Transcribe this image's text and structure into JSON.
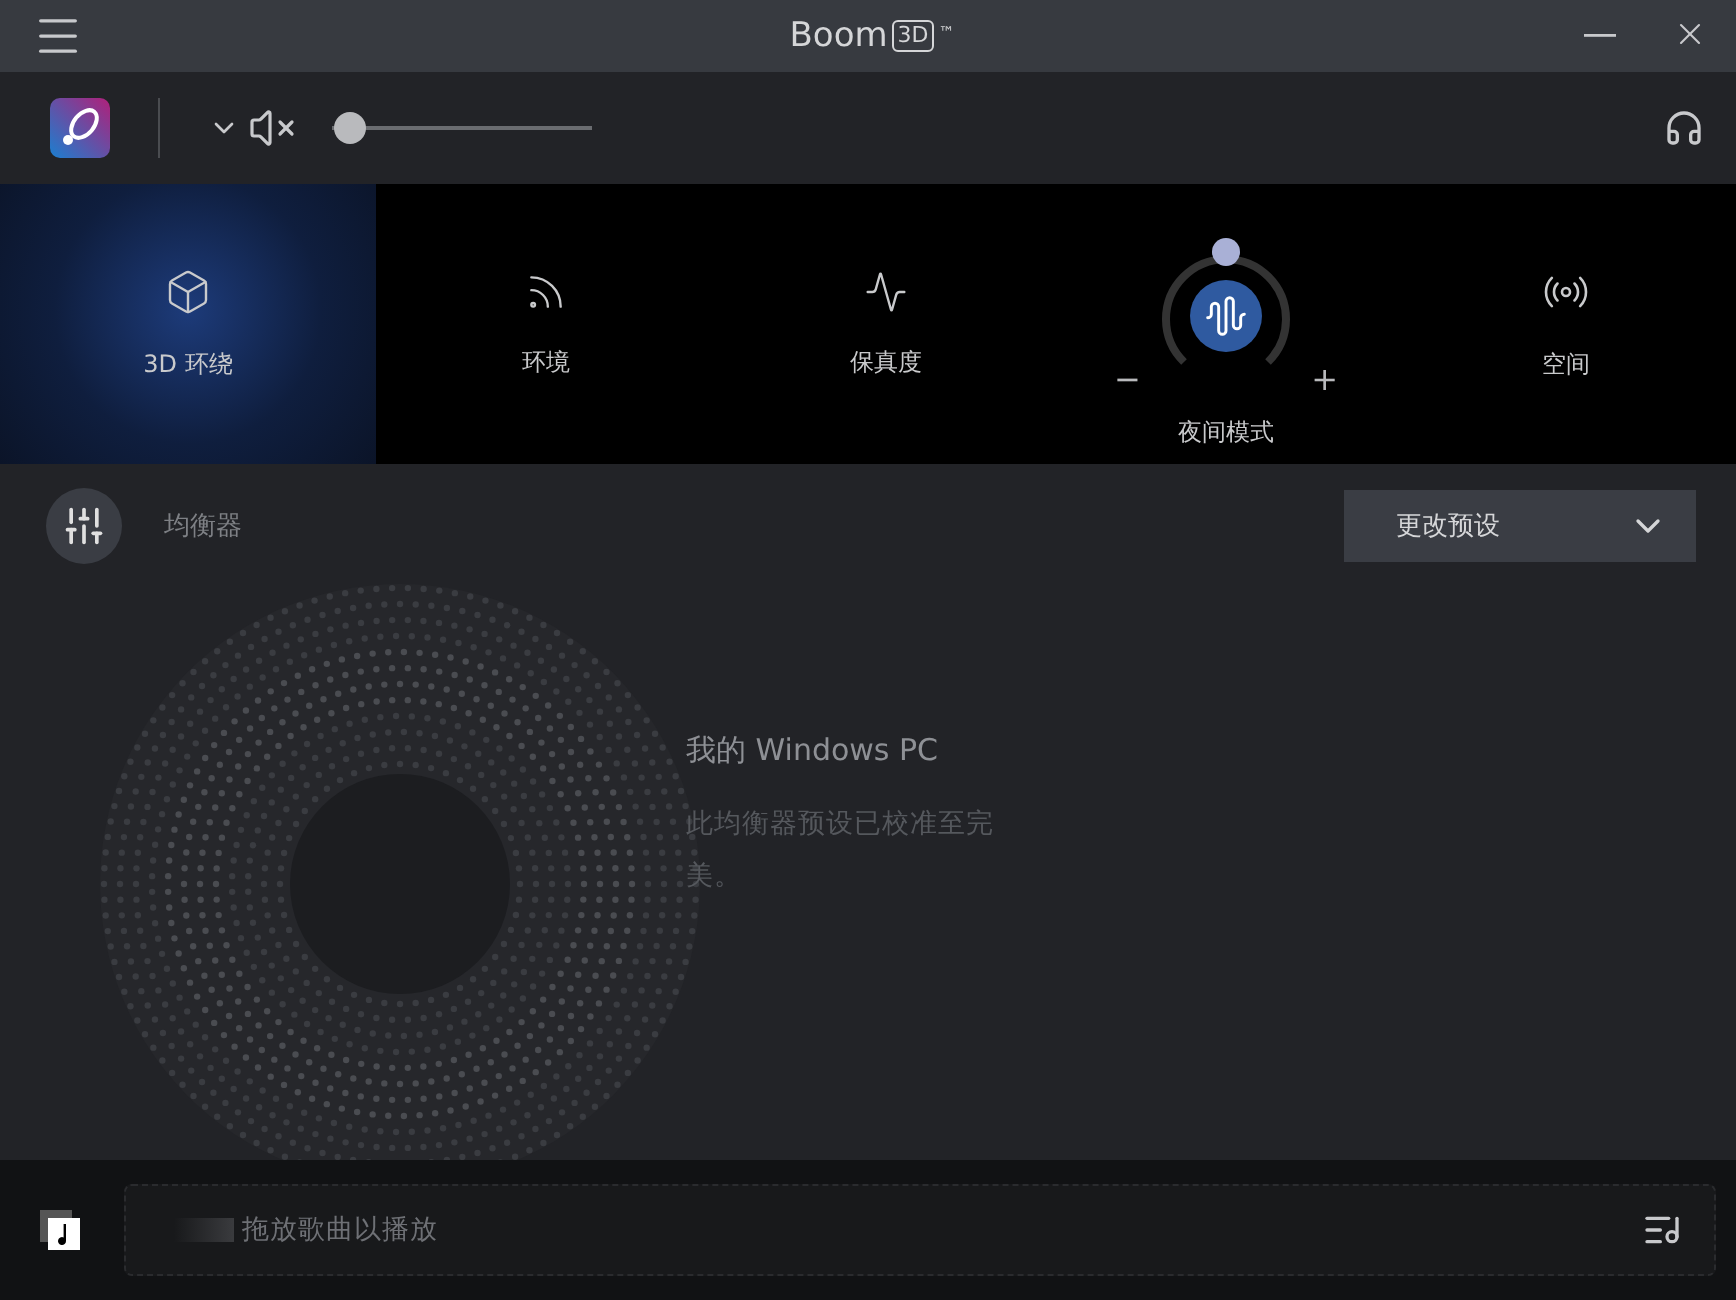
{
  "window": {
    "title": "Boom",
    "title_badge": "3D",
    "trademark": "™"
  },
  "toolbar": {
    "muted": true,
    "volume": {
      "level": 0.07
    }
  },
  "effects": [
    {
      "kind": "toggle",
      "label": "3D 环绕",
      "selected": true
    },
    {
      "kind": "toggle",
      "label": "环境",
      "selected": false
    },
    {
      "kind": "toggle",
      "label": "保真度",
      "selected": false
    },
    {
      "kind": "dial",
      "label": "夜间模式",
      "selected": false,
      "minus": "−",
      "plus": "+"
    },
    {
      "kind": "toggle",
      "label": "空间",
      "selected": false
    }
  ],
  "equalizer": {
    "label": "均衡器",
    "preset_button": "更改预设",
    "preset_title": "我的 Windows PC",
    "preset_description": "此均衡器预设已校准至完美。"
  },
  "player": {
    "drop_text": "拖放歌曲以播放"
  }
}
